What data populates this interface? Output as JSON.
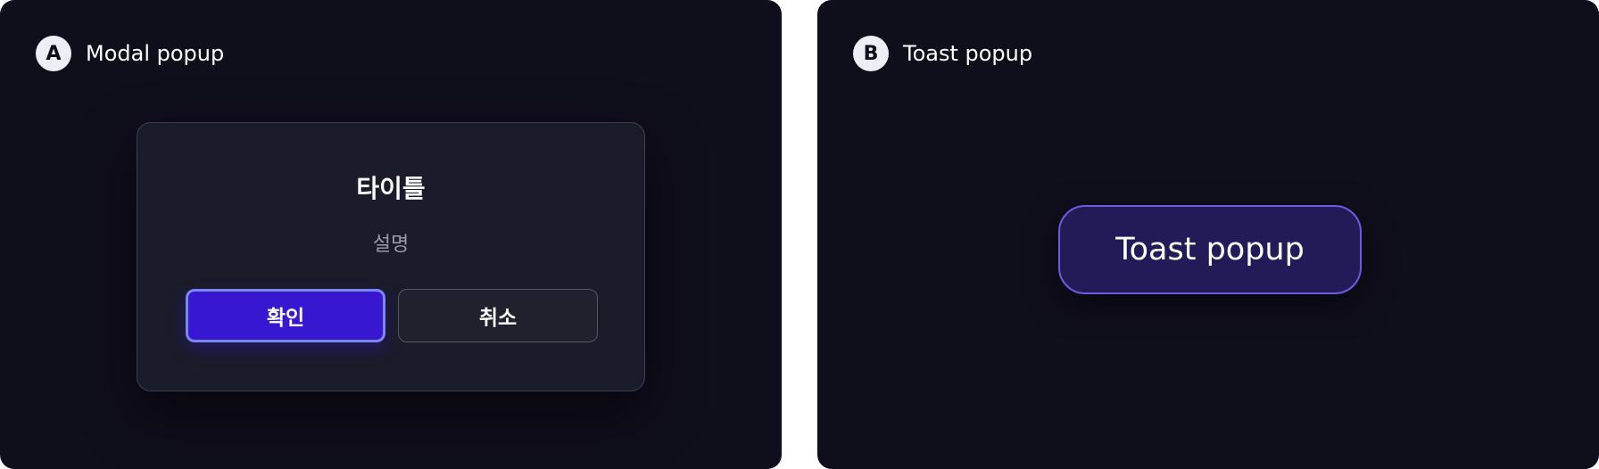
{
  "panel_a": {
    "badge": "A",
    "title": "Modal popup",
    "modal": {
      "title": "타이틀",
      "description": "설명",
      "confirm_label": "확인",
      "cancel_label": "취소"
    }
  },
  "panel_b": {
    "badge": "B",
    "title": "Toast popup",
    "toast": {
      "message": "Toast popup"
    }
  },
  "colors": {
    "panel_background": "#0f0e1b",
    "modal_background": "#1b1c2a",
    "confirm_button": "#3718d0",
    "confirm_border": "#7e86f5",
    "toast_background": "#231b57",
    "toast_border": "#6a5ce0",
    "badge_background": "#eeeef6"
  }
}
